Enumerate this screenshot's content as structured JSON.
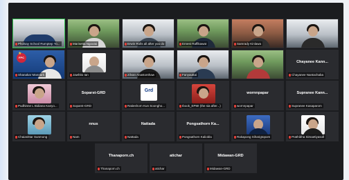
{
  "participants": [
    {
      "name": "Pholsay School Rumptep Yo...",
      "display": ""
    },
    {
      "name": "Marisetta Ngoutai",
      "display": ""
    },
    {
      "name": "Erwin Rolls all after you do",
      "display": ""
    },
    {
      "name": "Ernest Raffikawat",
      "display": ""
    },
    {
      "name": "Samrady Kinlawa",
      "display": ""
    },
    {
      "name": "",
      "display": ""
    },
    {
      "name": "Shanakar Mannark",
      "display": ""
    },
    {
      "name": "Jawhito Ian",
      "display": ""
    },
    {
      "name": "Zilvan Anastonthaw",
      "display": ""
    },
    {
      "name": "Fanyauttai",
      "display": ""
    },
    {
      "name": "",
      "display": ""
    },
    {
      "name": "Chayanee Nantachaba",
      "display": "Chayanee Kann..."
    },
    {
      "name": "Pudhinne L Bidiana Kanyo...",
      "display": ""
    },
    {
      "name": "Soparst-GRD",
      "display": "Soparst-GRD"
    },
    {
      "name": "Ratieshorn Kun Soongho...",
      "display": ""
    },
    {
      "name": "Ibook_EPMI (the sia after...)",
      "display": ""
    },
    {
      "name": "wornnpapar",
      "display": "wornnpapar"
    },
    {
      "name": "Supranee Kasaparom",
      "display": "Supranee Kann..."
    },
    {
      "name": "Chaianittar Sunmong",
      "display": ""
    },
    {
      "name": "Nam",
      "display": "nnus"
    },
    {
      "name": "Nattada",
      "display": "Nattada"
    },
    {
      "name": "Pongsathorn Kaliobla",
      "display": "Pongsathorn Ka..."
    },
    {
      "name": "Rakapong Siharigtopom",
      "display": ""
    },
    {
      "name": "Prathibha Simaetiyasoll",
      "display": ""
    },
    {
      "name": "Thanaporn.ch",
      "display": "Thanaporn.ch"
    },
    {
      "name": "atichar",
      "display": "atichar"
    },
    {
      "name": "Midawan-GRD",
      "display": "Midawan-GRD"
    }
  ],
  "logos": {
    "fpc": "FPC",
    "grd": "Grd"
  },
  "colors": {
    "active_border": "#31c24d",
    "muted_mic": "#e0413a",
    "window_bg": "#1b1c1f",
    "tile_bg": "#2a2b2f"
  },
  "icons": [
    "muted-mic-icon",
    "star-icon"
  ]
}
